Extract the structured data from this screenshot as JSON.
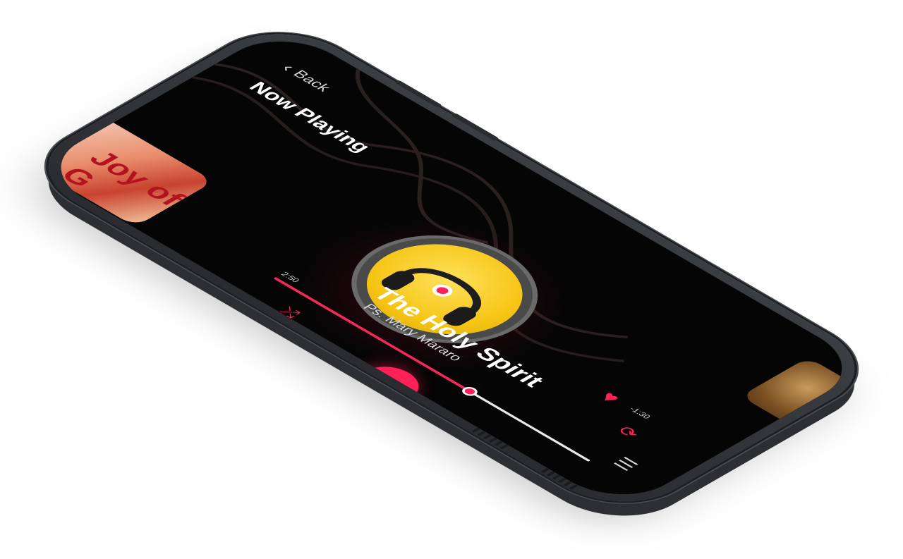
{
  "header": {
    "back_label": "Back",
    "title": "Now Playing"
  },
  "track": {
    "title": "The Holy Spirit",
    "artist": "Ps. Mary Mararo",
    "liked": true
  },
  "playback": {
    "elapsed": "2:50",
    "remaining": "-1:30",
    "progress": 0.62,
    "state": "playing"
  },
  "album_left": {
    "text": "Joy of G"
  },
  "icons": {
    "back": "chevron-left-icon",
    "heart": "heart-icon",
    "repeat": "repeat-icon",
    "previous": "skip-previous-icon",
    "pause": "pause-icon",
    "next": "skip-next-icon",
    "queue": "queue-list-icon",
    "shuffle": "shuffle-icon",
    "share": "share-icon"
  },
  "colors": {
    "accent": "#ff2158",
    "screen_bg": "#050505",
    "disc_yellow": "#f6c515",
    "phone_body": "#2c2e32"
  }
}
